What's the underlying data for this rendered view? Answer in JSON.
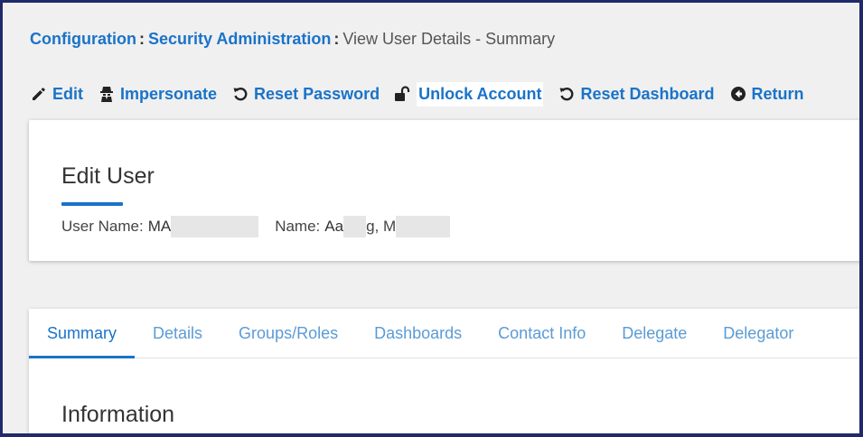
{
  "breadcrumb": {
    "items": [
      "Configuration",
      "Security Administration"
    ],
    "separator": ":",
    "current": "View User Details - Summary"
  },
  "toolbar": {
    "actions": [
      {
        "label": "Edit",
        "icon": "pencil-icon"
      },
      {
        "label": "Impersonate",
        "icon": "user-secret-icon"
      },
      {
        "label": "Reset Password",
        "icon": "undo-icon"
      },
      {
        "label": "Unlock Account",
        "icon": "unlock-icon",
        "highlighted": true
      },
      {
        "label": "Reset Dashboard",
        "icon": "undo-icon"
      },
      {
        "label": "Return",
        "icon": "arrow-left-circle-icon"
      }
    ]
  },
  "card": {
    "title": "Edit User",
    "user_name_label": "User Name:",
    "user_name_value": "MA",
    "name_label": "Name:",
    "name_value_part1": "Aa",
    "name_value_part2": "g, M"
  },
  "tabs": {
    "items": [
      "Summary",
      "Details",
      "Groups/Roles",
      "Dashboards",
      "Contact Info",
      "Delegate",
      "Delegator"
    ],
    "active_index": 0
  },
  "section": {
    "title": "Information"
  },
  "colors": {
    "accent": "#1a73c8",
    "tab_inactive": "#5b9bd5",
    "border": "#1f2a6b",
    "background": "#f0f0f0"
  }
}
